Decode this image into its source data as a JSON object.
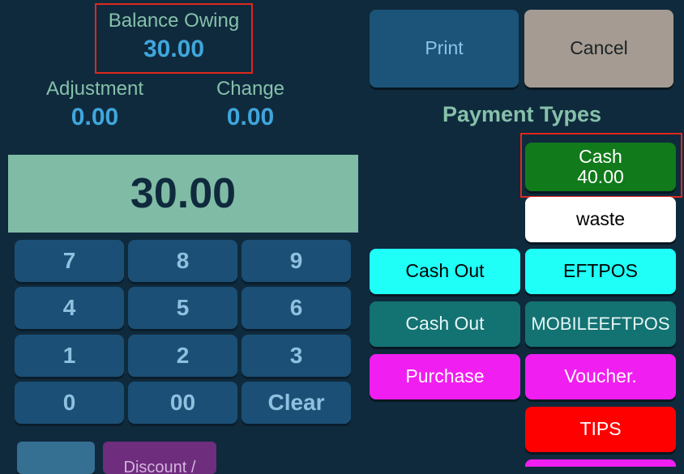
{
  "summary": {
    "balance_owing": {
      "label": "Balance Owing",
      "value": "30.00"
    },
    "adjustment": {
      "label": "Adjustment",
      "value": "0.00"
    },
    "change": {
      "label": "Change",
      "value": "0.00"
    }
  },
  "display": {
    "amount": "30.00"
  },
  "keypad": [
    "7",
    "8",
    "9",
    "4",
    "5",
    "6",
    "1",
    "2",
    "3",
    "0",
    "00",
    "Clear"
  ],
  "actions": {
    "print": "Print",
    "cancel": "Cancel",
    "discount": "Discount /"
  },
  "payment_types": {
    "heading": "Payment Types",
    "cash": {
      "label": "Cash",
      "amount": "40.00"
    },
    "waste": "waste",
    "cash_out_1": "Cash Out",
    "eftpos": "EFTPOS",
    "cash_out_2": "Cash Out",
    "mobile_eftpos": "MOBILEEFTPOS",
    "purchase": "Purchase",
    "voucher": "Voucher.",
    "tips": "TIPS"
  },
  "colors": {
    "background": "#0f2a3d",
    "highlight": "#e0281e",
    "cash_green": "#117a1b",
    "cyan": "#1ffff7",
    "teal": "#137272",
    "magenta": "#f01ef0",
    "red": "#ff0000"
  }
}
